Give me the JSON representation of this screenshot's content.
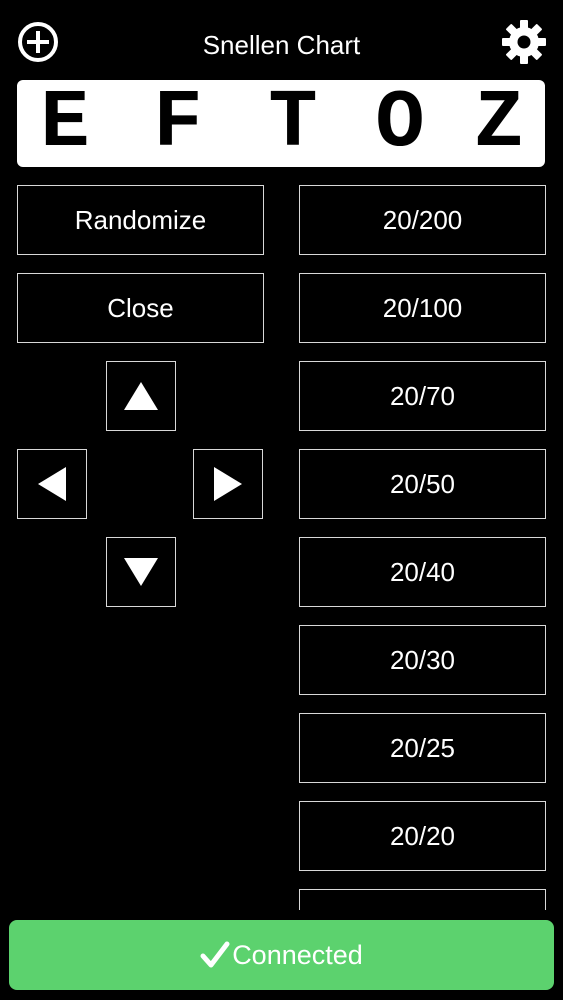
{
  "header": {
    "title": "Snellen Chart",
    "add_icon": "plus-circle-icon",
    "settings_icon": "gear-icon"
  },
  "chart": {
    "letters": [
      "E",
      "F",
      "T",
      "O",
      "Z"
    ]
  },
  "controls": {
    "randomize_label": "Randomize",
    "close_label": "Close",
    "arrow_icons": [
      "triangle-up-icon",
      "triangle-left-icon",
      "triangle-right-icon",
      "triangle-down-icon"
    ]
  },
  "acuity": {
    "levels": [
      "20/200",
      "20/100",
      "20/70",
      "20/50",
      "20/40",
      "20/30",
      "20/25",
      "20/20",
      ""
    ]
  },
  "status": {
    "label": "Connected",
    "icon": "checkmark-icon",
    "color": "#5cd26e"
  }
}
